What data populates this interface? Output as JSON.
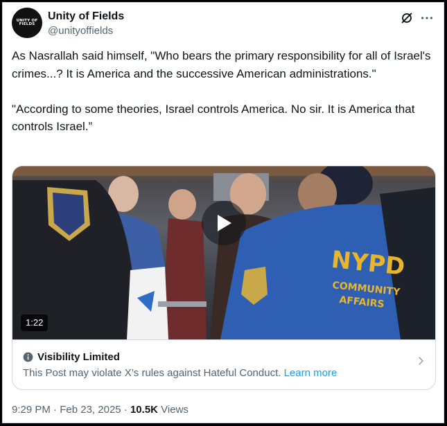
{
  "author": {
    "avatar_text": "UNITY OF FIELDS",
    "display_name": "Unity of Fields",
    "handle": "@unityoffields"
  },
  "post": {
    "text": "As Nasrallah said himself, \"Who bears the primary responsibility for all of Israel's crimes...? It is America and the successive American administrations.\"\n\n\"According to some theories, Israel controls America. No sir. It is America that controls Israel.”"
  },
  "media": {
    "duration": "1:22",
    "badge_text_1": "NYPD",
    "badge_text_2": "COMMUNITY",
    "badge_text_3": "AFFAIRS"
  },
  "notice": {
    "title": "Visibility Limited",
    "body": "This Post may violate X’s rules against Hateful Conduct.",
    "link": "Learn more"
  },
  "meta": {
    "time": "9:29 PM",
    "separator": "·",
    "date": "Feb 23, 2025",
    "views_count": "10.5K",
    "views_label": "Views"
  },
  "colors": {
    "link": "#1d9bf0",
    "secondary_text": "#536471",
    "primary_text": "#0f1419",
    "nypd_jacket": "#2f5fb3",
    "nypd_text": "#e7b62b"
  },
  "icons": [
    "grok-icon",
    "more-icon",
    "play-icon",
    "info-icon",
    "chevron-right-icon"
  ]
}
